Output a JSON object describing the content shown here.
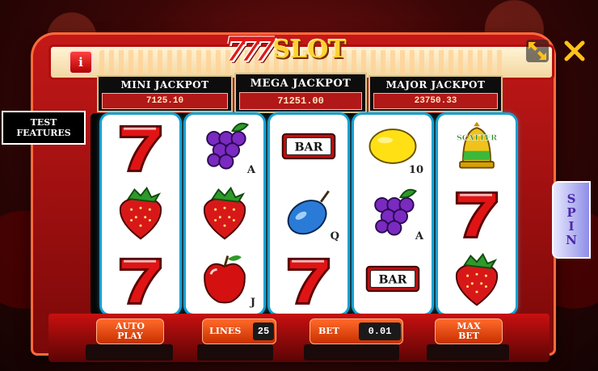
{
  "logo": {
    "sevens": "777",
    "word": "SLOT"
  },
  "info_label": "i",
  "jackpots": {
    "mini": {
      "title": "MINI JACKPOT",
      "value": "7125.10"
    },
    "mega": {
      "title": "MEGA JACKPOT",
      "value": "71251.00"
    },
    "major": {
      "title": "MAJOR JACKPOT",
      "value": "23750.33"
    }
  },
  "test_features": {
    "line1": "TEST",
    "line2": "FEATURES"
  },
  "reels": [
    {
      "symbols": [
        {
          "icon": "seven-icon",
          "corner": ""
        },
        {
          "icon": "strawberry-icon",
          "corner": ""
        },
        {
          "icon": "seven-icon",
          "corner": ""
        }
      ]
    },
    {
      "symbols": [
        {
          "icon": "grapes-icon",
          "corner": "A"
        },
        {
          "icon": "strawberry-icon",
          "corner": ""
        },
        {
          "icon": "apple-icon",
          "corner": "J"
        }
      ]
    },
    {
      "symbols": [
        {
          "icon": "bar-icon",
          "corner": "",
          "text": "BAR"
        },
        {
          "icon": "plum-icon",
          "corner": "Q"
        },
        {
          "icon": "seven-icon",
          "corner": ""
        }
      ]
    },
    {
      "symbols": [
        {
          "icon": "lemon-icon",
          "corner": "10"
        },
        {
          "icon": "grapes-icon",
          "corner": "A"
        },
        {
          "icon": "bar-icon",
          "corner": "",
          "text": "BAR"
        }
      ]
    },
    {
      "symbols": [
        {
          "icon": "scatter-bell-icon",
          "corner": "",
          "text": "SCATTER"
        },
        {
          "icon": "seven-icon",
          "corner": ""
        },
        {
          "icon": "strawberry-icon",
          "corner": ""
        }
      ]
    }
  ],
  "spin_letters": [
    "S",
    "P",
    "I",
    "N"
  ],
  "controls": {
    "auto_play": {
      "line1": "AUTO",
      "line2": "PLAY"
    },
    "lines": {
      "label": "LINES",
      "value": "25"
    },
    "bet": {
      "label": "BET",
      "value": "0.01"
    },
    "max_bet": {
      "line1": "MAX",
      "line2": "BET"
    }
  },
  "colors": {
    "reel_glow": "#1aa0d0",
    "cabinet_red": "#c41818",
    "gold": "#ffd233"
  }
}
